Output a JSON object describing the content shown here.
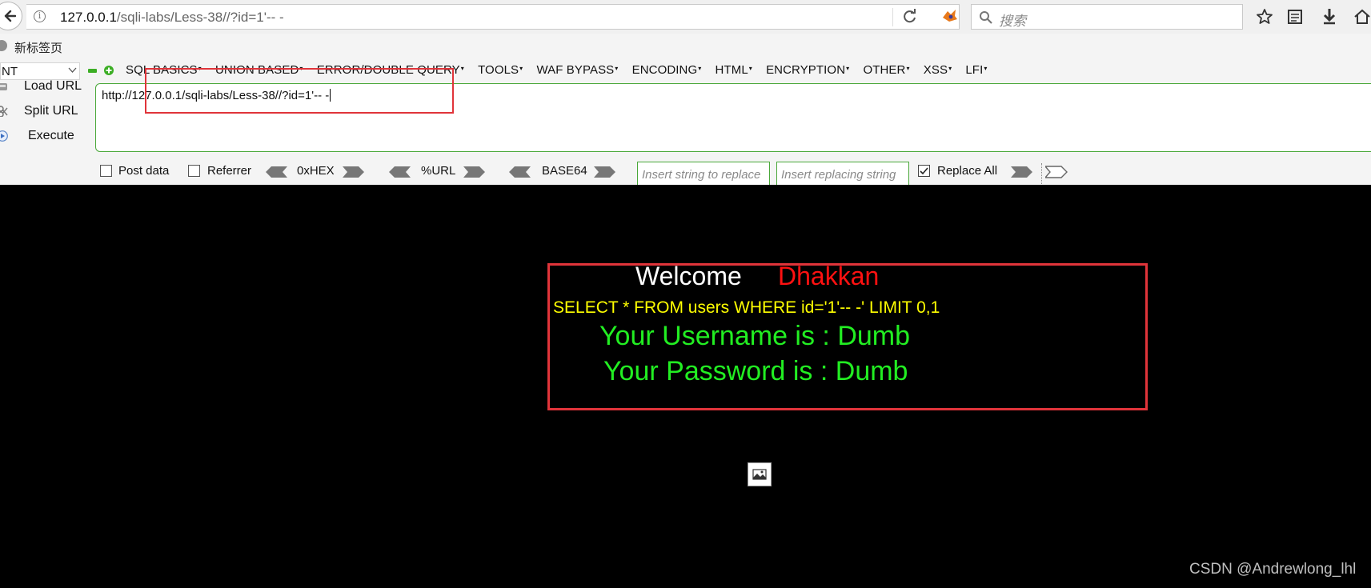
{
  "browser": {
    "url_host": "127.0.0.1",
    "url_path": "/sqli-labs/Less-38//?id=1'-- -",
    "search_placeholder": "搜索",
    "bookmark_label": "新标签页"
  },
  "hackbar": {
    "select_value": "NT",
    "menu": [
      "SQL BASICS",
      "UNION BASED",
      "ERROR/DOUBLE QUERY",
      "TOOLS",
      "WAF BYPASS",
      "ENCODING",
      "HTML",
      "ENCRYPTION",
      "OTHER",
      "XSS",
      "LFI"
    ],
    "load_url": "Load URL",
    "split_url": "Split URL",
    "execute": "Execute",
    "url_value": "http://127.0.0.1/sqli-labs/Less-38//?id=1'-- -",
    "post_data": "Post data",
    "referrer": "Referrer",
    "hex": "0xHEX",
    "url_enc": "%URL",
    "base64": "BASE64",
    "replace_placeholder": "Insert string to replace",
    "replacing_placeholder": "Insert replacing string",
    "replace_all": "Replace All",
    "replace_all_checked": true
  },
  "page": {
    "welcome": "Welcome",
    "name": "Dhakkan",
    "query": "SELECT * FROM users WHERE id='1'-- -' LIMIT 0,1",
    "username_line": "Your Username is : Dumb",
    "password_line": "Your Password is : Dumb"
  },
  "watermark": "CSDN @Andrewlong_lhl",
  "colors": {
    "annotation": "#e0343a",
    "hackbar_green": "#4aa83a",
    "query_yellow": "#ffff00",
    "result_green": "#22ee22",
    "name_red": "#ff1111"
  },
  "icons": [
    "back-arrow-icon",
    "info-icon",
    "reload-icon",
    "fox-icon",
    "search-icon",
    "star-icon",
    "reading-list-icon",
    "download-icon",
    "home-icon",
    "globe-icon",
    "minus-icon",
    "plus-icon",
    "broken-image-icon"
  ]
}
